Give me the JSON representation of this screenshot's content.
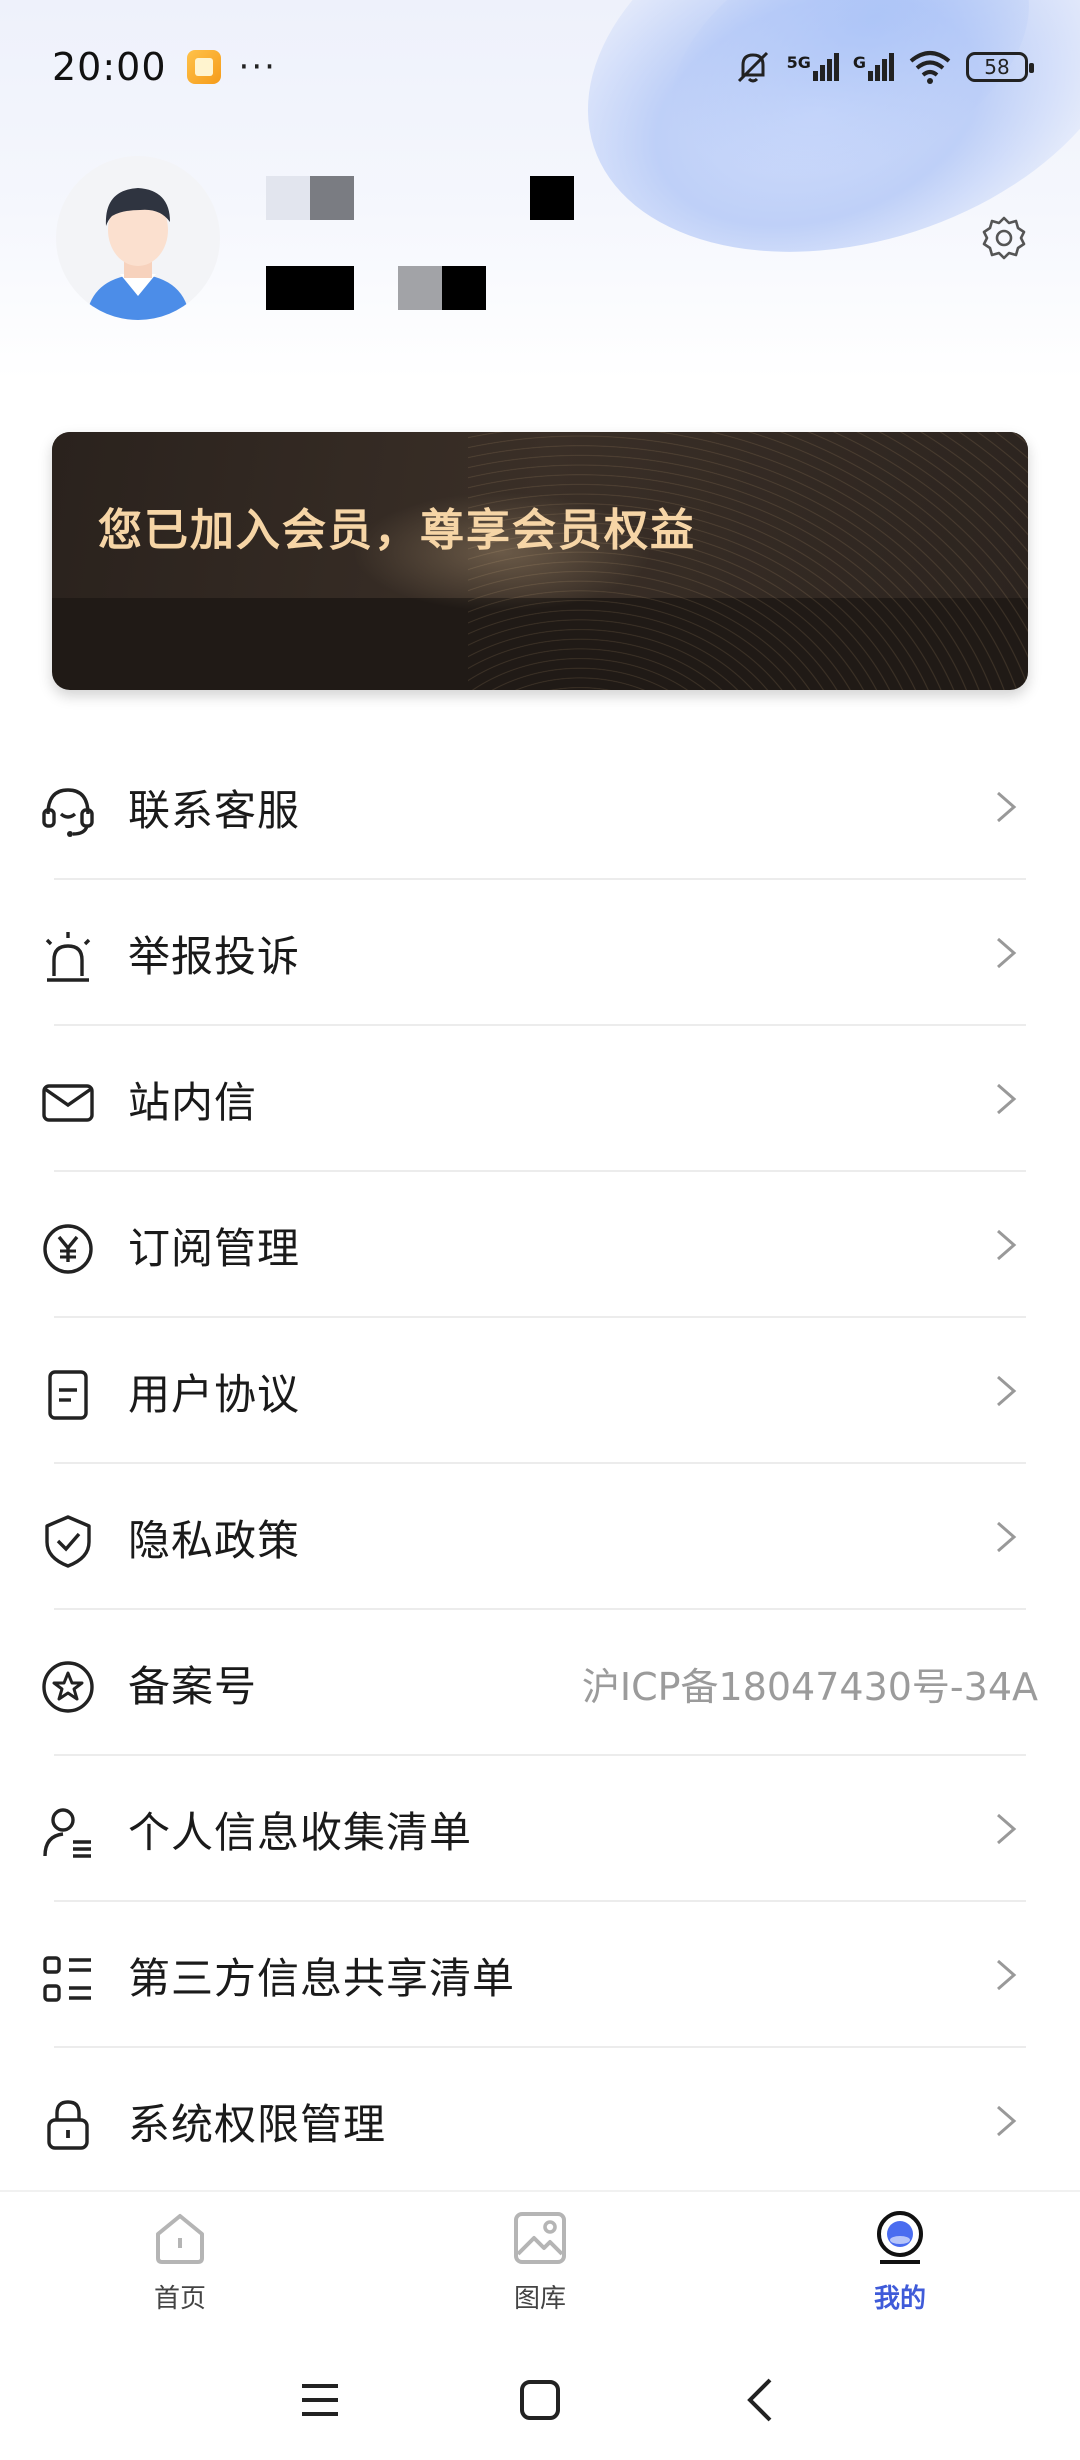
{
  "status_bar": {
    "time": "20:00",
    "dots": "···",
    "network_1": "5G",
    "network_2": "G",
    "battery": "58"
  },
  "member_card": {
    "text": "您已加入会员，尊享会员权益"
  },
  "menu": {
    "items": [
      {
        "label": "联系客服",
        "icon": "headset-icon"
      },
      {
        "label": "举报投诉",
        "icon": "alarm-icon"
      },
      {
        "label": "站内信",
        "icon": "mail-icon"
      },
      {
        "label": "订阅管理",
        "icon": "yen-icon"
      },
      {
        "label": "用户协议",
        "icon": "document-icon"
      },
      {
        "label": "隐私政策",
        "icon": "shield-check-icon"
      },
      {
        "label": "备案号",
        "icon": "star-badge-icon",
        "value": "沪ICP备18047430号-34A"
      },
      {
        "label": "个人信息收集清单",
        "icon": "user-list-icon"
      },
      {
        "label": "第三方信息共享清单",
        "icon": "list-grid-icon"
      },
      {
        "label": "系统权限管理",
        "icon": "lock-icon"
      }
    ]
  },
  "bottom_nav": {
    "items": [
      {
        "label": "首页",
        "icon": "home-icon"
      },
      {
        "label": "图库",
        "icon": "gallery-icon"
      },
      {
        "label": "我的",
        "icon": "profile-icon"
      }
    ],
    "active": "我的"
  },
  "colors": {
    "accent": "#3f5bd9",
    "member_text": "#f6d5a6",
    "member_bg": "#201a16"
  }
}
